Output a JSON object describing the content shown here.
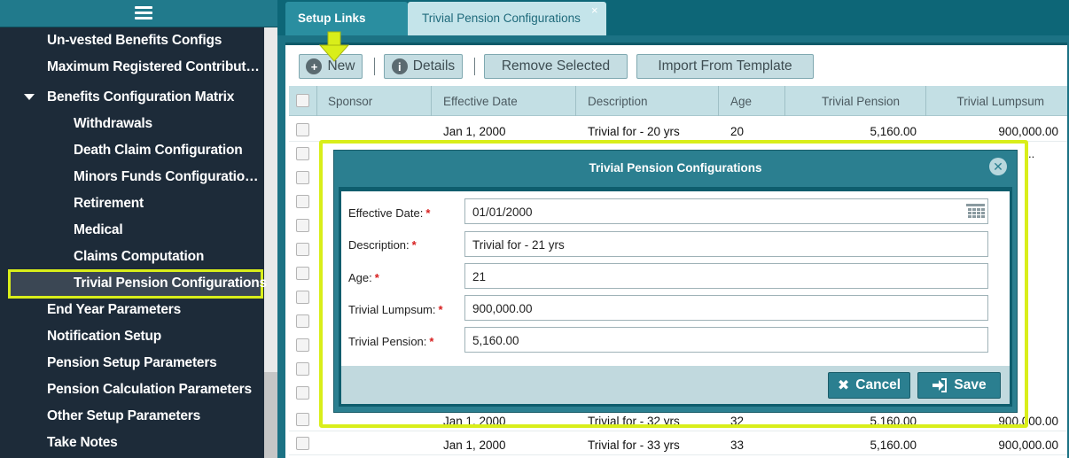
{
  "sidebar": {
    "items": [
      {
        "label": "Un-vested Benefits Configs"
      },
      {
        "label": "Maximum Registered Contributi..."
      },
      {
        "label": "Benefits Configuration Matrix"
      },
      {
        "label": "Withdrawals"
      },
      {
        "label": "Death Claim Configuration"
      },
      {
        "label": "Minors Funds Configuration ..."
      },
      {
        "label": "Retirement"
      },
      {
        "label": "Medical"
      },
      {
        "label": "Claims Computation"
      },
      {
        "label": "Trivial Pension Configurations"
      },
      {
        "label": "End Year Parameters"
      },
      {
        "label": "Notification Setup"
      },
      {
        "label": "Pension Setup Parameters"
      },
      {
        "label": "Pension Calculation Parameters"
      },
      {
        "label": "Other Setup Parameters"
      },
      {
        "label": "Take Notes"
      }
    ]
  },
  "tabs": {
    "setup": "Setup Links",
    "active": "Trivial Pension Configurations",
    "close": "×"
  },
  "toolbar": {
    "new": "New",
    "details": "Details",
    "remove": "Remove Selected",
    "import": "Import From Template"
  },
  "grid": {
    "columns": [
      "Sponsor",
      "Effective Date",
      "Description",
      "Age",
      "Trivial Pension",
      "Trivial Lumpsum"
    ],
    "rows": [
      {
        "date": "Jan 1, 2000",
        "desc": "Trivial for - 20 yrs",
        "age": "20",
        "pension": "5,160.00",
        "lump": "900,000.00"
      },
      {
        "date": "Jan 1, 2000",
        "desc": "Trivial for - 32 yrs",
        "age": "32",
        "pension": "5,160.00",
        "lump": "900,000.00"
      },
      {
        "date": "Jan 1, 2000",
        "desc": "Trivial for - 33 yrs",
        "age": "33",
        "pension": "5,160.00",
        "lump": "900,000.00"
      }
    ],
    "partial_pension": "5,160.00",
    "partial_lump": "900,000.00"
  },
  "dialog": {
    "title": "Trivial Pension Configurations",
    "fields": {
      "effective_date": {
        "label": "Effective Date:",
        "value": "01/01/2000"
      },
      "description": {
        "label": "Description:",
        "value": "Trivial for - 21 yrs"
      },
      "age": {
        "label": "Age:",
        "value": "21"
      },
      "lumpsum": {
        "label": "Trivial Lumpsum:",
        "value": "900,000.00"
      },
      "pension": {
        "label": "Trivial Pension:",
        "value": "5,160.00"
      }
    },
    "required_mark": "*",
    "cancel": "Cancel",
    "save": "Save"
  },
  "colors": {
    "sidebar_bg": "#1d2b39",
    "accent": "#2b7f90",
    "highlight": "#d9ee1a"
  }
}
